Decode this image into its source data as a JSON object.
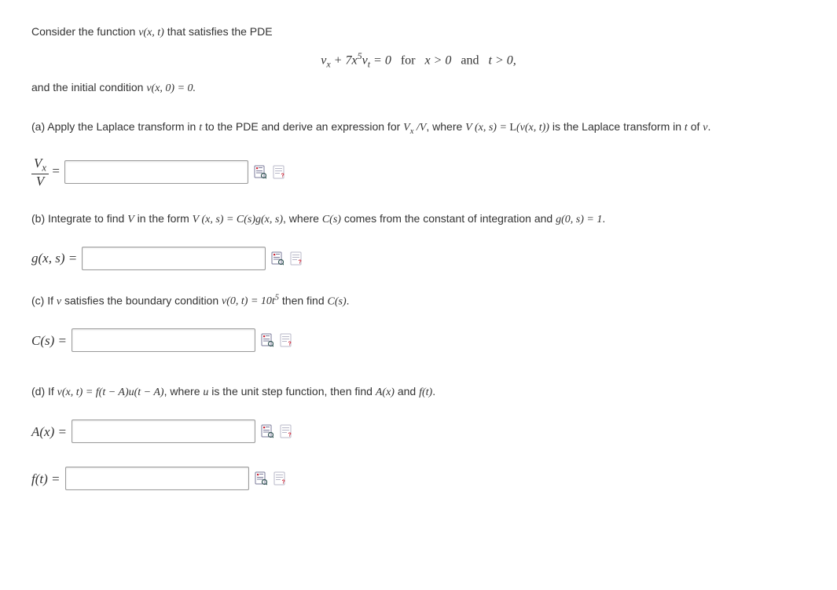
{
  "intro": {
    "line1_pre": "Consider the function ",
    "line1_math": "v(x, t)",
    "line1_post": " that satisfies the PDE",
    "pde_html": "v<sub>x</sub> + 7x<sup>5</sup>v<sub>t</sub> = 0&nbsp;&nbsp;&nbsp;<span class='roman'>for</span>&nbsp;&nbsp;&nbsp;x &gt; 0&nbsp;&nbsp;&nbsp;<span class='roman'>and</span>&nbsp;&nbsp;&nbsp;t &gt; 0,",
    "line2_pre": "and the initial condition ",
    "line2_math": "v(x, 0) = 0.",
    "line2_post": ""
  },
  "parts": {
    "a": {
      "prompt_pre": "(a) Apply the Laplace transform in ",
      "prompt_t": "t",
      "prompt_mid1": " to the PDE and derive an expression for ",
      "prompt_expr1": "V<sub>x</sub> /V",
      "prompt_mid2": ", where ",
      "prompt_expr2": "V (x, s) = <span class='cal'>L</span>(v(x, t))",
      "prompt_mid3": " is the Laplace transform in ",
      "prompt_t2": "t",
      "prompt_post": " of ",
      "prompt_v": "v",
      "prompt_end": ".",
      "label_num": "V<sub>x</sub>",
      "label_den": "V",
      "eq": " ="
    },
    "b": {
      "prompt_pre": "(b) Integrate to find ",
      "prompt_V": "V",
      "prompt_mid1": " in the form ",
      "prompt_expr1": "V (x, s) = C(s)g(x, s)",
      "prompt_mid2": ", where ",
      "prompt_Cs": "C(s)",
      "prompt_mid3": " comes from the constant of integration and ",
      "prompt_g0": "g(0, s) = 1",
      "prompt_end": ".",
      "label": "g(x, s) ="
    },
    "c": {
      "prompt_pre": "(c) If ",
      "prompt_v": "v",
      "prompt_mid1": " satisfies the boundary condition ",
      "prompt_bc": "v(0, t) = 10t<sup>5</sup>",
      "prompt_mid2": " then find ",
      "prompt_Cs": "C(s)",
      "prompt_end": ".",
      "label": "C(s) ="
    },
    "d": {
      "prompt_pre": "(d) If ",
      "prompt_eq": "v(x, t) = f(t − A)u(t − A)",
      "prompt_mid1": ", where ",
      "prompt_u": "u",
      "prompt_mid2": " is the unit step function, then find ",
      "prompt_Ax": "A(x)",
      "prompt_and": " and ",
      "prompt_ft": "f(t)",
      "prompt_end": ".",
      "label_A": "A(x) =",
      "label_f": "f(t) ="
    }
  }
}
